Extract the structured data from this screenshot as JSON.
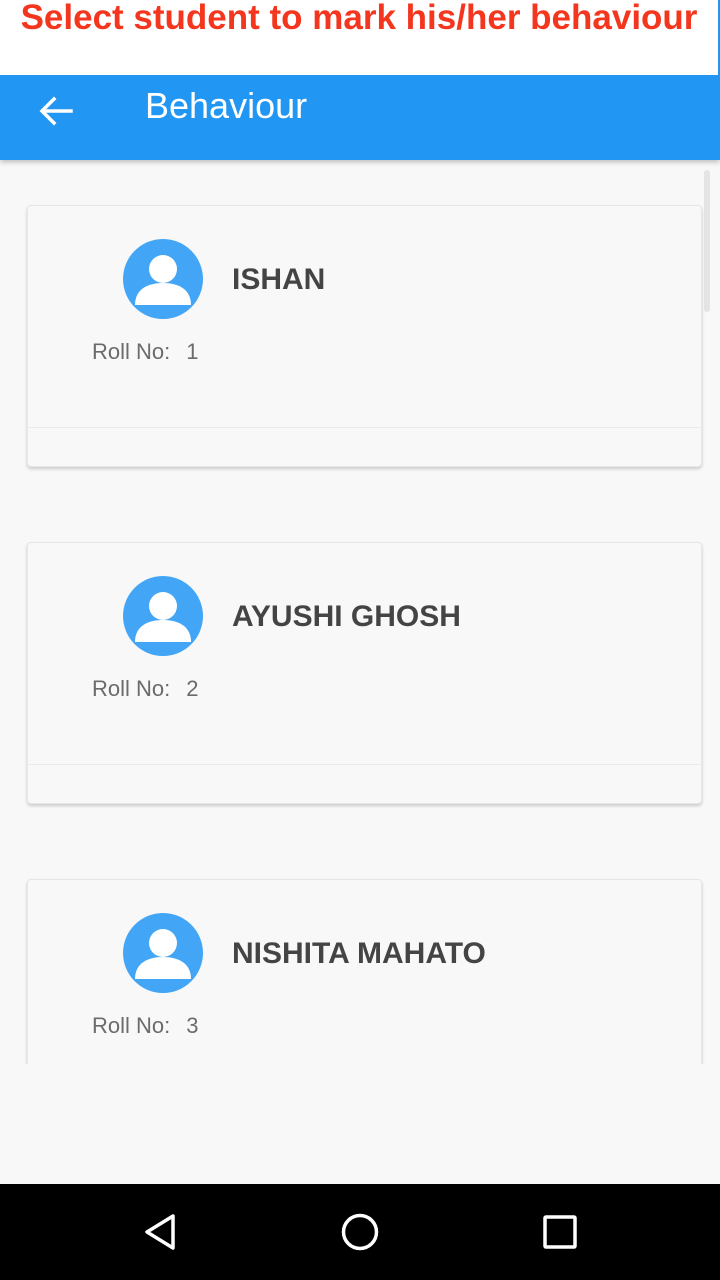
{
  "banner": {
    "text": "Select student to mark his/her behaviour"
  },
  "appbar": {
    "title": "Behaviour",
    "back_icon": "arrow-left-icon",
    "color": "#2196f3"
  },
  "students": [
    {
      "name": "ISHAN",
      "roll_label": "Roll No:",
      "roll_no": "1"
    },
    {
      "name": "AYUSHI GHOSH",
      "roll_label": "Roll No:",
      "roll_no": "2"
    },
    {
      "name": "NISHITA MAHATO",
      "roll_label": "Roll No:",
      "roll_no": "3"
    }
  ],
  "navbar": {
    "icons": [
      "triangle-back-icon",
      "circle-home-icon",
      "square-recents-icon"
    ]
  },
  "colors": {
    "accent": "#2196f3",
    "avatar": "#42a5f5",
    "banner_text": "#f4361f"
  }
}
